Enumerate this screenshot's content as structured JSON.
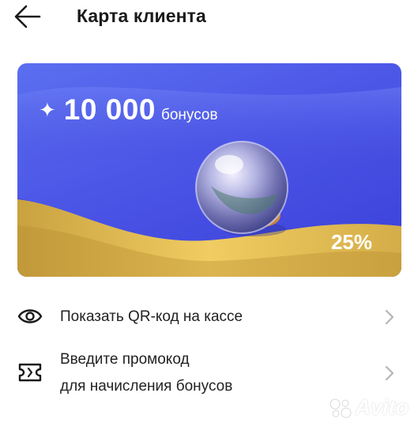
{
  "header": {
    "title": "Карта клиента",
    "back_icon": "arrow-left-icon"
  },
  "card": {
    "star_glyph": "✦",
    "bonus_amount": "10 000",
    "bonus_unit": "бонусов",
    "percent": "25%",
    "colors": {
      "background": "#4b55e6",
      "wave": "#e4b94b"
    }
  },
  "menu": {
    "qr": {
      "label": "Показать QR-код на кассе",
      "icon": "eye-icon"
    },
    "promo": {
      "line1": "Введите промокод",
      "line2": "для начисления бонусов",
      "icon": "ticket-icon"
    }
  },
  "watermark": {
    "text": "Avito"
  }
}
